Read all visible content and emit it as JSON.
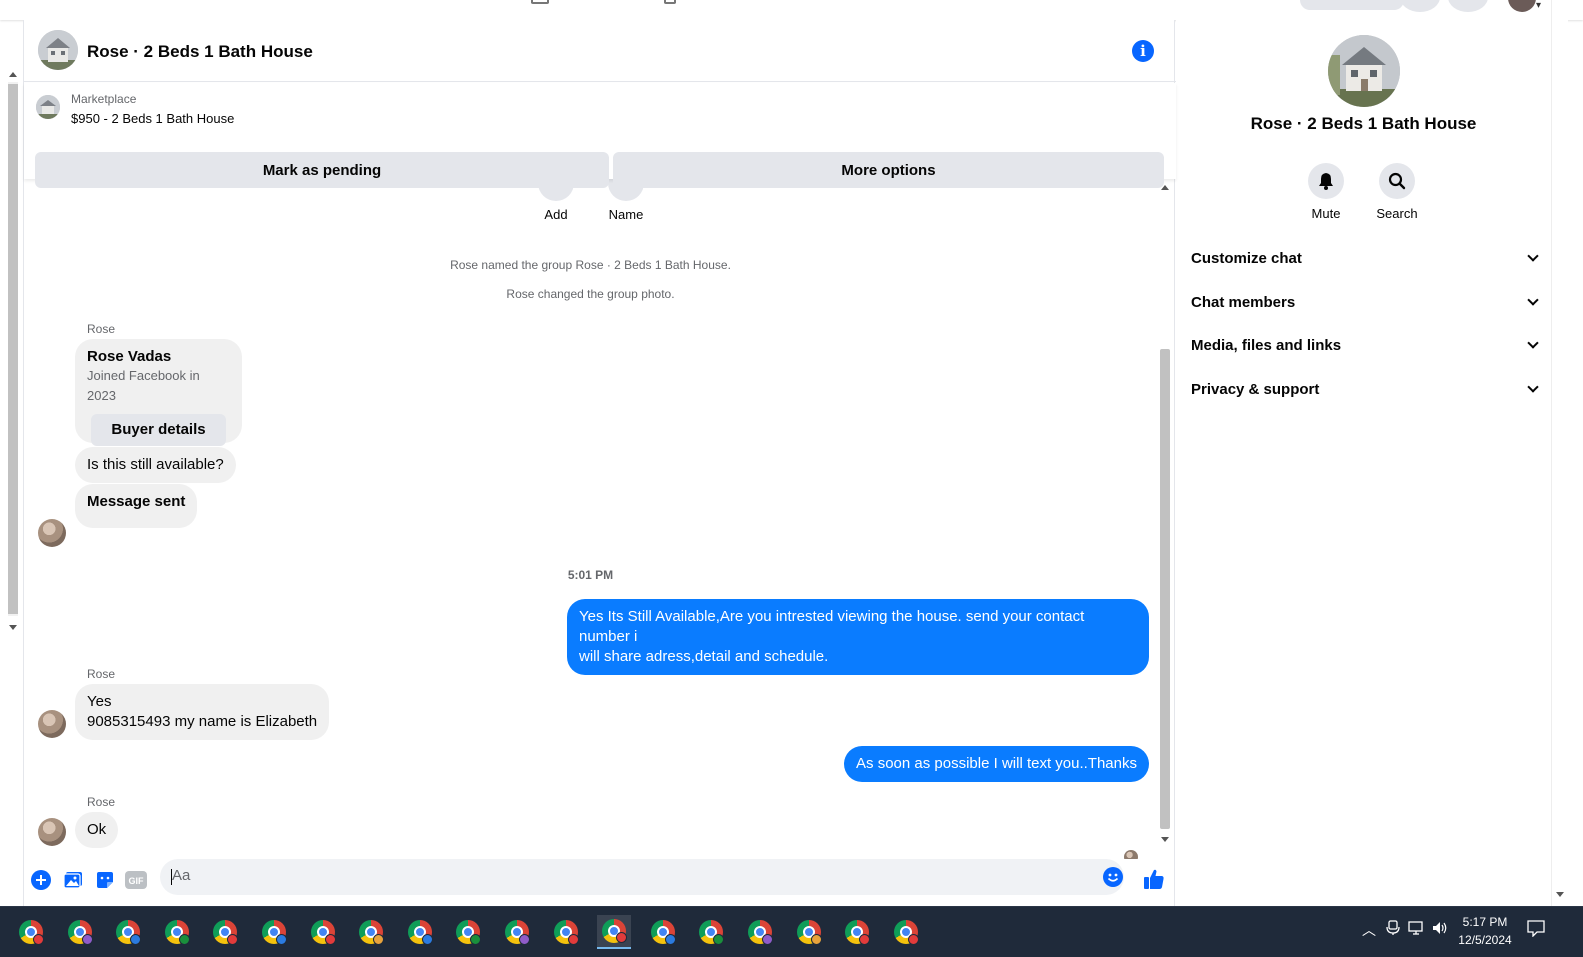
{
  "chat": {
    "title": "Rose · 2 Beds 1 Bath House",
    "marketplace": {
      "label": "Marketplace",
      "listing": "$950 - 2 Beds 1 Bath House",
      "mark_pending": "Mark as pending",
      "more_options": "More options"
    },
    "actions": {
      "add": "Add",
      "name": "Name"
    },
    "system_messages": [
      "Rose named the group Rose · 2 Beds 1 Bath House.",
      "Rose changed the group photo."
    ],
    "buyer_card": {
      "sender": "Rose",
      "name": "Rose Vadas",
      "joined": "Joined Facebook in 2023",
      "button": "Buyer details"
    },
    "messages": [
      {
        "from": "Rose",
        "text": "Is this still available?"
      },
      {
        "from": "Rose",
        "text": "Message sent"
      },
      {
        "timestamp": "5:01 PM"
      },
      {
        "from": "me",
        "line1": "Yes Its Still Available,Are you intrested viewing the house. send your contact number i",
        "line2": "will share adress,detail and schedule."
      },
      {
        "from": "Rose",
        "sender": "Rose",
        "line1": "Yes",
        "line2": "9085315493 my name is Elizabeth"
      },
      {
        "from": "me",
        "text": "As soon as possible I will text you..Thanks"
      },
      {
        "from": "Rose",
        "sender": "Rose",
        "text": "Ok"
      }
    ],
    "composer": {
      "placeholder": "Aa"
    }
  },
  "panel": {
    "title": "Rose · 2 Beds 1 Bath House",
    "mute": "Mute",
    "search": "Search",
    "sections": [
      "Customize chat",
      "Chat members",
      "Media, files and links",
      "Privacy & support"
    ]
  },
  "taskbar": {
    "time": "5:17 PM",
    "date": "12/5/2024",
    "profile_colors": [
      "#e23b3b",
      "#8f5cc9",
      "#2b7be0",
      "#1a8f3c",
      "#e23b3b",
      "#2b7be0",
      "#e23b3b",
      "#e8a33c",
      "#2b7be0",
      "#1a8f3c",
      "#8f5cc9",
      "#e23b3b",
      "#e23b3b",
      "#2b7be0",
      "#1a8f3c",
      "#8f5cc9",
      "#e8a33c",
      "#e23b3b",
      "#e23b3b"
    ]
  },
  "colors": {
    "accent": "#0866ff",
    "outgoing_bubble": "#0a7cff",
    "incoming_bubble": "#f0f0f0"
  }
}
